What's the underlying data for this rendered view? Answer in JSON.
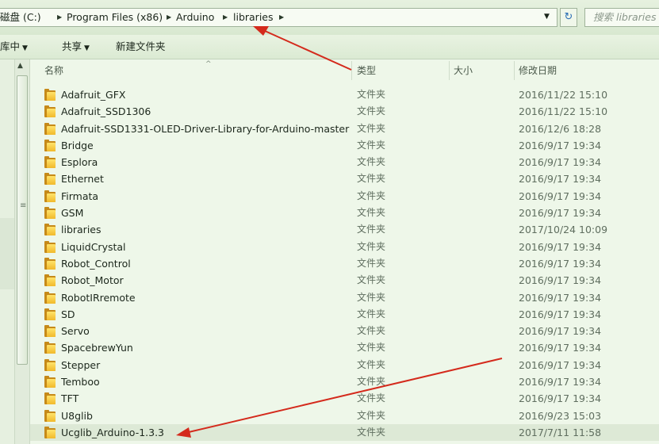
{
  "address": {
    "crumbs": [
      "磁盘 (C:)",
      "Program Files (x86)",
      "Arduino",
      "libraries"
    ],
    "separator": "▶",
    "dropdown_glyph": "▼",
    "refresh_glyph": "↻",
    "search_placeholder": "搜索 libraries"
  },
  "toolbar": {
    "library": "库中",
    "share": "共享",
    "new_folder": "新建文件夹",
    "caret": "▼"
  },
  "columns": {
    "name": "名称",
    "type": "类型",
    "size": "大小",
    "date": "修改日期",
    "sort_glyph": "^"
  },
  "scroll": {
    "up_glyph": "▲",
    "grip_glyph": "≡"
  },
  "files": [
    {
      "name": "Adafruit_GFX",
      "type": "文件夹",
      "date": "2016/11/22 15:10"
    },
    {
      "name": "Adafruit_SSD1306",
      "type": "文件夹",
      "date": "2016/11/22 15:10"
    },
    {
      "name": "Adafruit-SSD1331-OLED-Driver-Library-for-Arduino-master",
      "type": "文件夹",
      "date": "2016/12/6 18:28"
    },
    {
      "name": "Bridge",
      "type": "文件夹",
      "date": "2016/9/17 19:34"
    },
    {
      "name": "Esplora",
      "type": "文件夹",
      "date": "2016/9/17 19:34"
    },
    {
      "name": "Ethernet",
      "type": "文件夹",
      "date": "2016/9/17 19:34"
    },
    {
      "name": "Firmata",
      "type": "文件夹",
      "date": "2016/9/17 19:34"
    },
    {
      "name": "GSM",
      "type": "文件夹",
      "date": "2016/9/17 19:34"
    },
    {
      "name": "libraries",
      "type": "文件夹",
      "date": "2017/10/24 10:09"
    },
    {
      "name": "LiquidCrystal",
      "type": "文件夹",
      "date": "2016/9/17 19:34"
    },
    {
      "name": "Robot_Control",
      "type": "文件夹",
      "date": "2016/9/17 19:34"
    },
    {
      "name": "Robot_Motor",
      "type": "文件夹",
      "date": "2016/9/17 19:34"
    },
    {
      "name": "RobotIRremote",
      "type": "文件夹",
      "date": "2016/9/17 19:34"
    },
    {
      "name": "SD",
      "type": "文件夹",
      "date": "2016/9/17 19:34"
    },
    {
      "name": "Servo",
      "type": "文件夹",
      "date": "2016/9/17 19:34"
    },
    {
      "name": "SpacebrewYun",
      "type": "文件夹",
      "date": "2016/9/17 19:34"
    },
    {
      "name": "Stepper",
      "type": "文件夹",
      "date": "2016/9/17 19:34"
    },
    {
      "name": "Temboo",
      "type": "文件夹",
      "date": "2016/9/17 19:34"
    },
    {
      "name": "TFT",
      "type": "文件夹",
      "date": "2016/9/17 19:34"
    },
    {
      "name": "U8glib",
      "type": "文件夹",
      "date": "2016/9/23 15:03"
    },
    {
      "name": "Ucglib_Arduino-1.3.3",
      "type": "文件夹",
      "date": "2017/7/11 11:58",
      "selected": true
    }
  ],
  "colors": {
    "annotation_arrow": "#d42a1c",
    "folder_front": "#f6c43a",
    "folder_back": "#c68a19"
  }
}
